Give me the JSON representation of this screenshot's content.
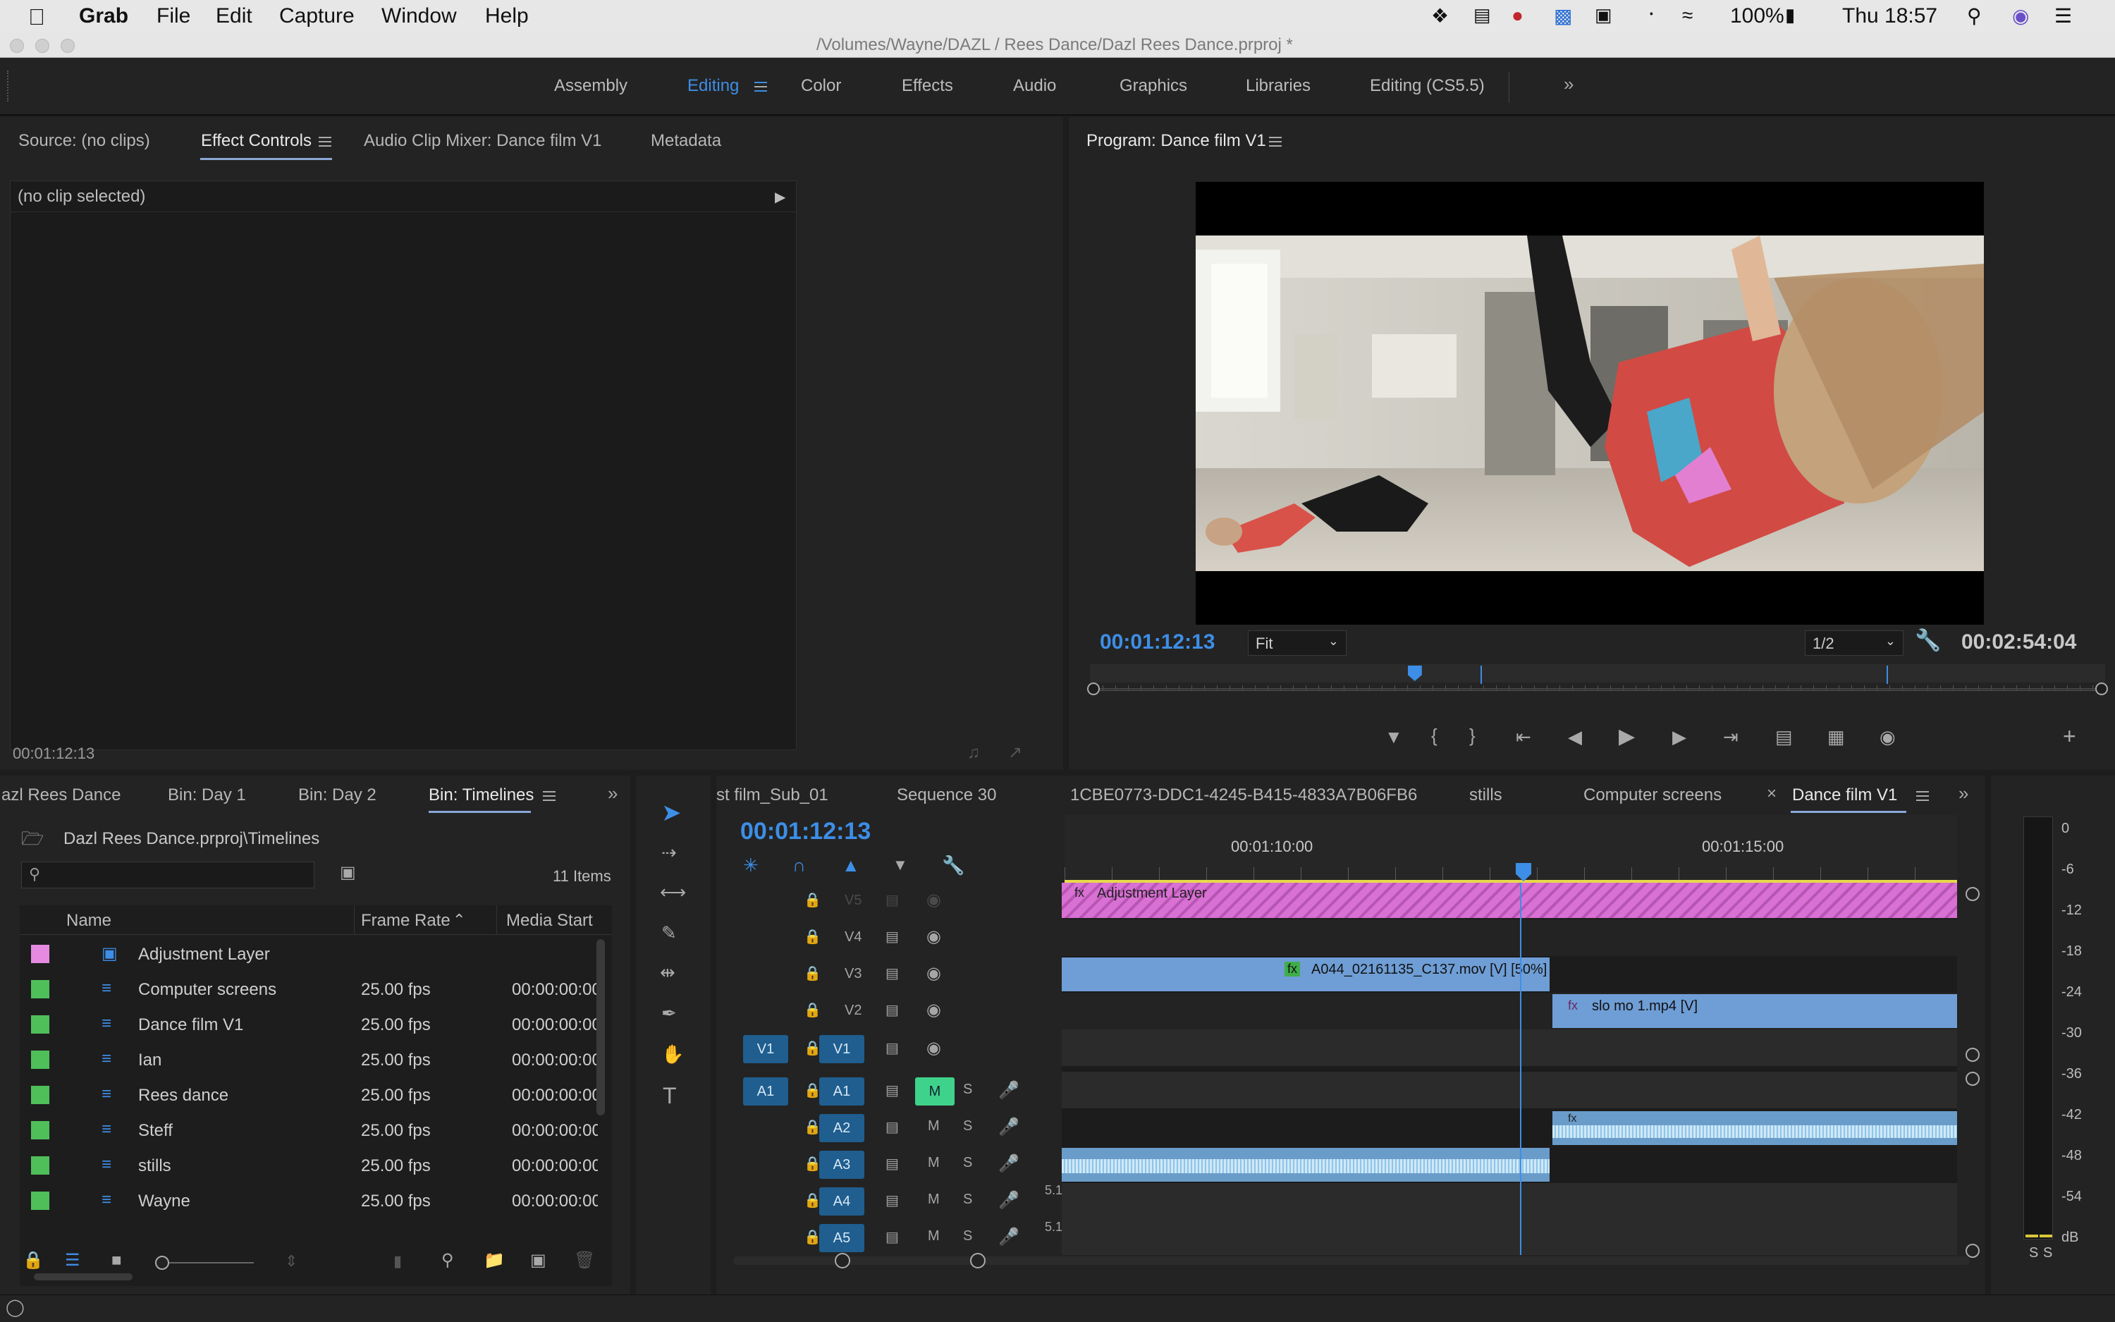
{
  "menubar": {
    "apple": "",
    "app": "Grab",
    "items": [
      "File",
      "Edit",
      "Capture",
      "Window",
      "Help"
    ],
    "battery": "100%",
    "clock": "Thu 18:57"
  },
  "window": {
    "title": "/Volumes/Wayne/DAZL / Rees Dance/Dazl Rees Dance.prproj *"
  },
  "workspaces": [
    "Assembly",
    "Editing",
    "Color",
    "Effects",
    "Audio",
    "Graphics",
    "Libraries",
    "Editing (CS5.5)"
  ],
  "source_panel": {
    "tabs": [
      "Source: (no clips)",
      "Effect Controls",
      "Audio Clip Mixer: Dance film V1",
      "Metadata"
    ],
    "no_clip": "(no clip selected)",
    "timecode": "00:01:12:13"
  },
  "program": {
    "title": "Program: Dance film V1",
    "timecode": "00:01:12:13",
    "fit": "Fit",
    "resolution": "1/2",
    "duration": "00:02:54:04",
    "playhead_fraction": 0.32
  },
  "project": {
    "tabs": [
      "azl Rees Dance",
      "Bin: Day 1",
      "Bin: Day 2",
      "Bin: Timelines"
    ],
    "path": "Dazl Rees Dance.prproj\\Timelines",
    "search_placeholder": "",
    "item_count": "11 Items",
    "columns": [
      "Name",
      "Frame Rate",
      "Media Start"
    ],
    "rows": [
      {
        "name": "Adjustment Layer",
        "rate": "",
        "start": "",
        "color": "#e58ae0"
      },
      {
        "name": "Computer screens",
        "rate": "25.00 fps",
        "start": "00:00:00:00",
        "color": "#4fbf5a"
      },
      {
        "name": "Dance film V1",
        "rate": "25.00 fps",
        "start": "00:00:00:00",
        "color": "#4fbf5a"
      },
      {
        "name": "Ian",
        "rate": "25.00 fps",
        "start": "00:00:00:00",
        "color": "#4fbf5a"
      },
      {
        "name": "Rees dance",
        "rate": "25.00 fps",
        "start": "00:00:00:00",
        "color": "#4fbf5a"
      },
      {
        "name": "Steff",
        "rate": "25.00 fps",
        "start": "00:00:00:00",
        "color": "#4fbf5a"
      },
      {
        "name": "stills",
        "rate": "25.00 fps",
        "start": "00:00:00:00",
        "color": "#4fbf5a"
      },
      {
        "name": "Wayne",
        "rate": "25.00 fps",
        "start": "00:00:00:00",
        "color": "#4fbf5a"
      }
    ]
  },
  "timeline": {
    "tabs": [
      "st film_Sub_01",
      "Sequence 30",
      "1CBE0773-DDC1-4245-B415-4833A7B06FB6",
      "stills",
      "Computer screens",
      "Dance film V1"
    ],
    "timecode": "00:01:12:13",
    "ruler": [
      "00:01:10:00",
      "00:01:15:00"
    ],
    "video_tracks": [
      "V5",
      "V4",
      "V3",
      "V2",
      "V1"
    ],
    "audio_tracks": [
      "A1",
      "A2",
      "A3",
      "A4",
      "A5"
    ],
    "source_patch_v": "V1",
    "source_patch_a": "A1",
    "mute": "M",
    "solo": "S",
    "label_51": "5.1",
    "clips": {
      "adjustment": "Adjustment Layer",
      "v3": "A044_02161135_C137.mov [V] [50%]",
      "v2": "slo mo 1.mp4 [V]",
      "fx": "fx"
    }
  },
  "meter": {
    "scale": [
      "0",
      "-6",
      "-12",
      "-18",
      "-24",
      "-30",
      "-36",
      "-42",
      "-48",
      "-54",
      "dB"
    ],
    "solo": [
      "S",
      "S"
    ]
  },
  "colors": {
    "accent": "#3d8ee6",
    "adjustment": "#d970d4",
    "video_clip": "#6f9ed6",
    "audio_clip": "#8fc4e8"
  }
}
